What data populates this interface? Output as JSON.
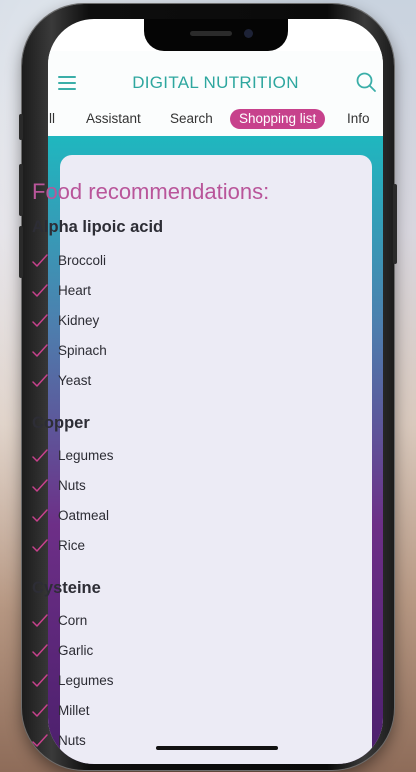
{
  "app": {
    "title": "DIGITAL NUTRITION"
  },
  "tabs": [
    {
      "label": "ll",
      "active": false
    },
    {
      "label": "Assistant",
      "active": false
    },
    {
      "label": "Search",
      "active": false
    },
    {
      "label": "Shopping list",
      "active": true
    },
    {
      "label": "Info",
      "active": false
    }
  ],
  "card": {
    "title": "Food recommendations:",
    "sections": [
      {
        "heading": "Alpha lipoic acid",
        "items": [
          "Broccoli",
          "Heart",
          "Kidney",
          "Spinach",
          "Yeast"
        ]
      },
      {
        "heading": "Copper",
        "items": [
          "Legumes",
          "Nuts",
          "Oatmeal",
          "Rice"
        ]
      },
      {
        "heading": "Cysteine",
        "items": [
          "Corn",
          "Garlic",
          "Legumes",
          "Millet",
          "Nuts"
        ]
      }
    ]
  },
  "icons": {
    "menu": "hamburger-menu-icon",
    "search": "search-icon",
    "check": "checkmark-icon"
  },
  "colors": {
    "brand": "#2ea79f",
    "accent": "#c7418c",
    "check": "#c7418c",
    "title": "#b9559a"
  }
}
